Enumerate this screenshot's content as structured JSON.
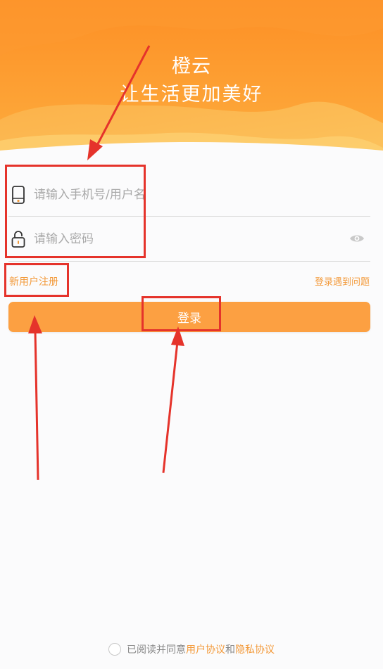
{
  "header": {
    "app_name": "橙云",
    "slogan": "让生活更加美好"
  },
  "form": {
    "account_placeholder": "请输入手机号/用户名",
    "password_placeholder": "请输入密码",
    "register_label": "新用户注册",
    "help_label": "登录遇到问题",
    "login_label": "登录"
  },
  "agreement": {
    "prefix": "已阅读并同意",
    "user_agreement": "用户协议",
    "conjunction": "和",
    "privacy_agreement": "隐私协议"
  },
  "colors": {
    "accent": "#fca042",
    "link": "#f39a3a",
    "highlight": "#e5332b"
  },
  "icons": [
    "phone-icon",
    "lock-icon",
    "eye-icon",
    "radio-icon"
  ]
}
